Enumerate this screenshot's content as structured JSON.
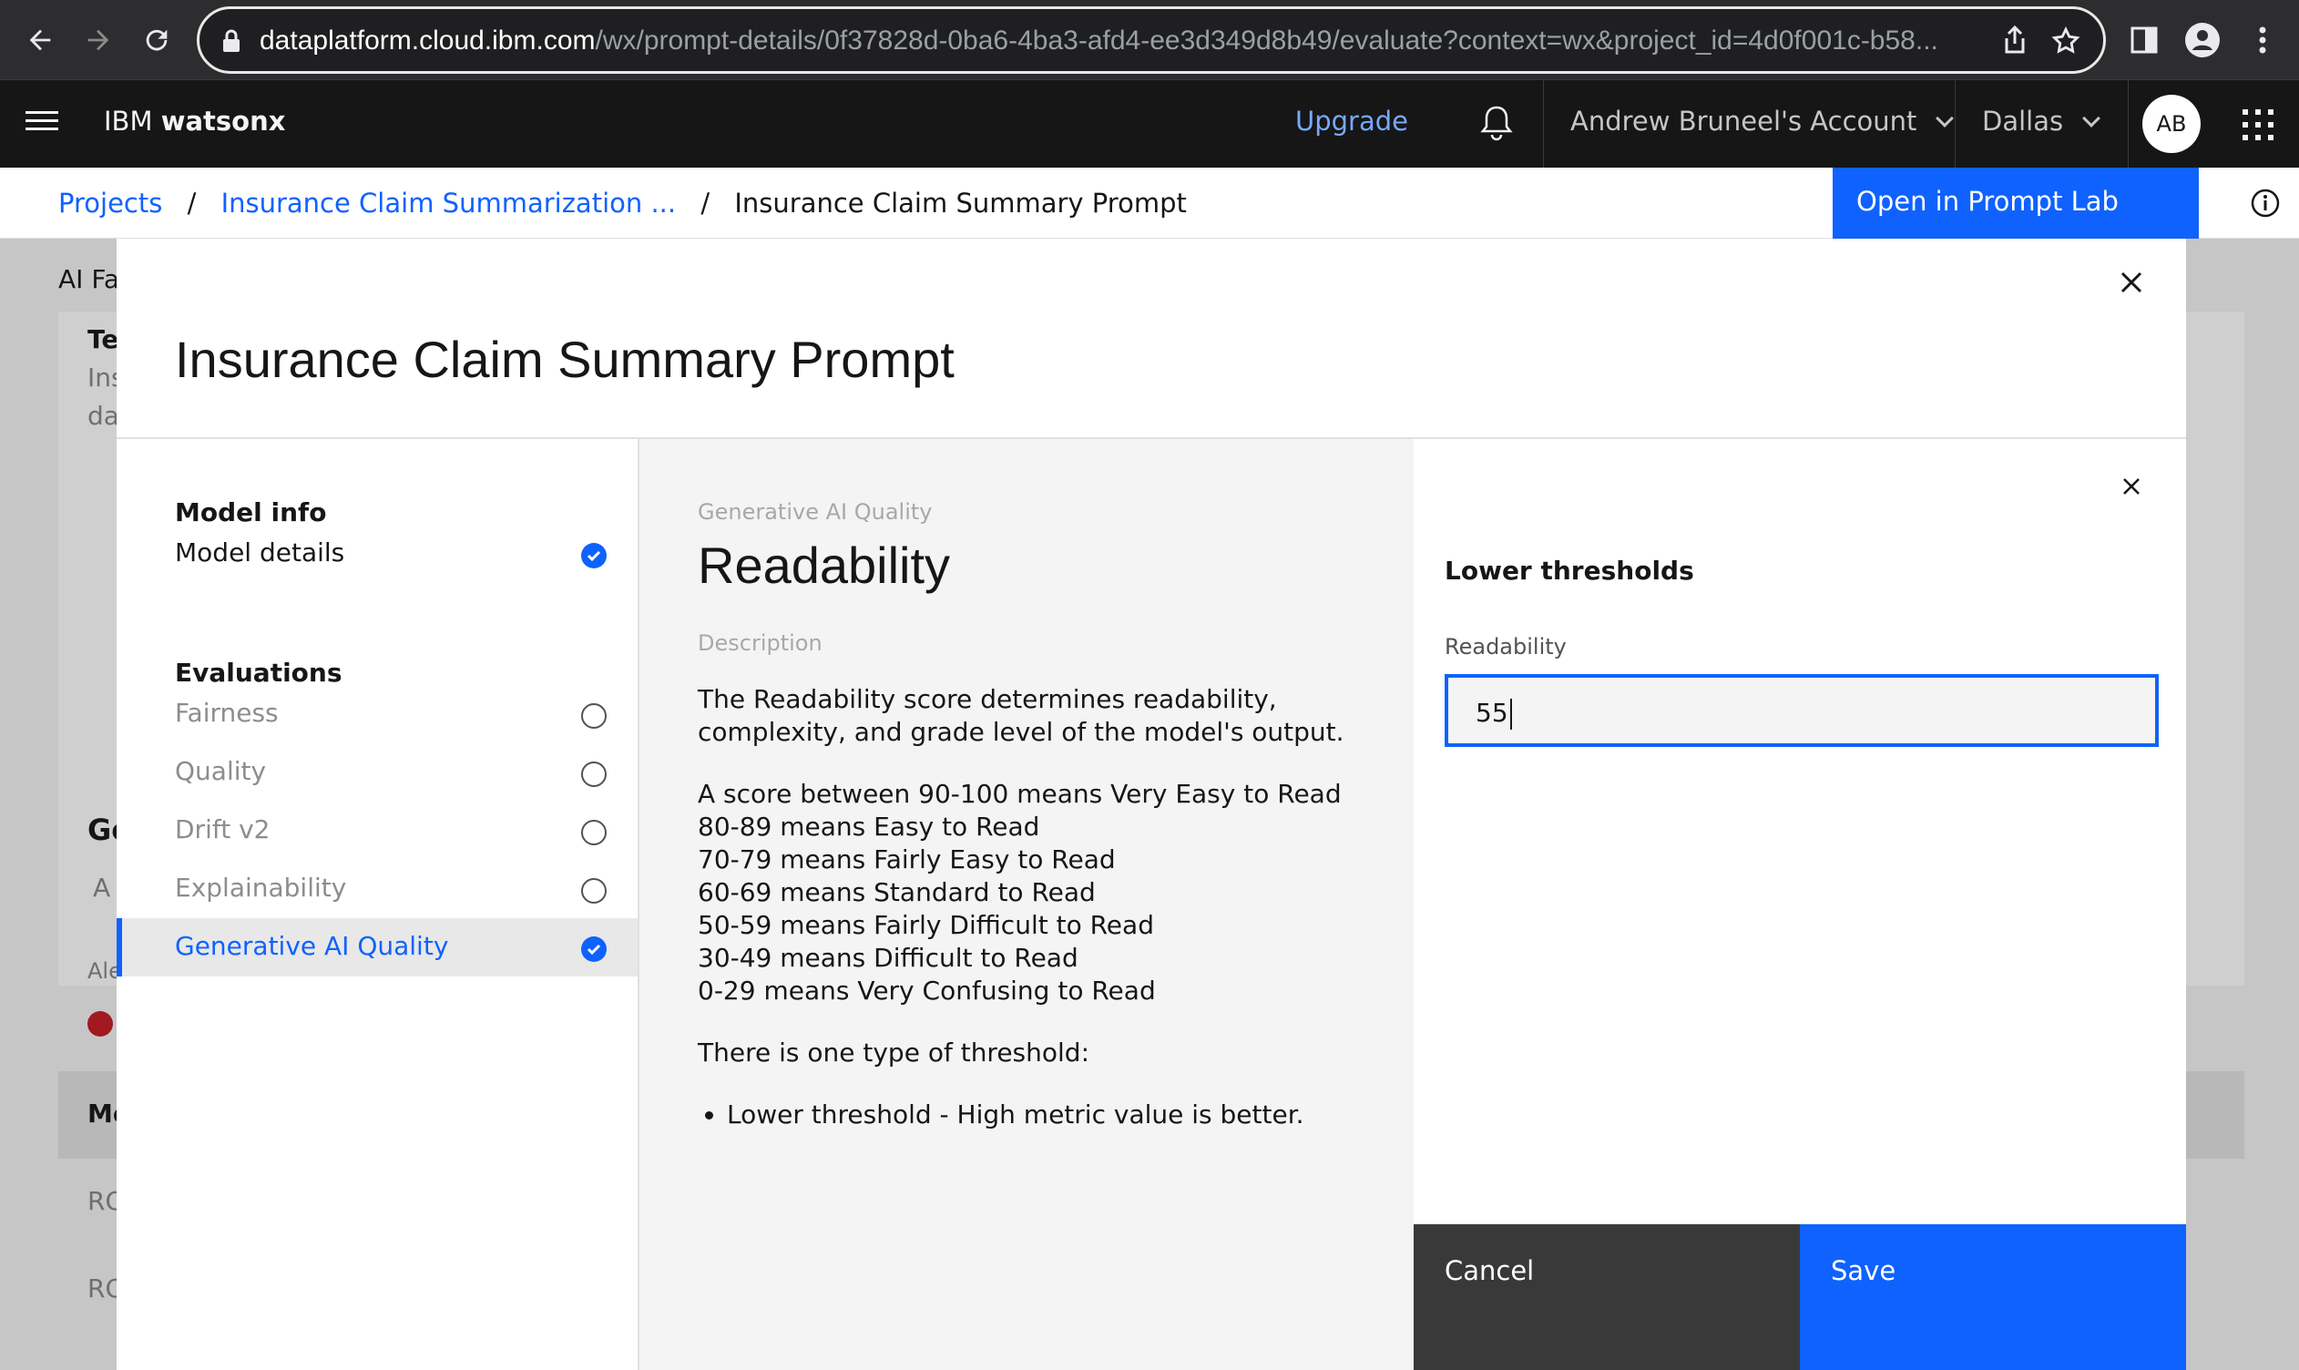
{
  "browser": {
    "url_host": "dataplatform.cloud.ibm.com",
    "url_path": "/wx/prompt-details/0f37828d-0ba6-4ba3-afd4-ee3d349d8b49/evaluate?context=wx&project_id=4d0f001c-b58..."
  },
  "header": {
    "brand_prefix": "IBM ",
    "brand_name": "watsonx",
    "upgrade": "Upgrade",
    "account": "Andrew Bruneel's Account",
    "region": "Dallas",
    "avatar_initials": "AB"
  },
  "breadcrumb": {
    "items": [
      "Projects",
      "Insurance Claim Summarization ..."
    ],
    "separator": "/",
    "current": "Insurance Claim Summary Prompt",
    "open_button": "Open in Prompt Lab"
  },
  "background": {
    "fragments": [
      "AI Fa",
      "Te",
      "Ins",
      "da",
      "Ge",
      "A",
      "Ale",
      "Me",
      "RO",
      "RO"
    ]
  },
  "modal": {
    "title": "Insurance Claim Summary Prompt",
    "nav": {
      "section1": "Model info",
      "model_details": "Model details",
      "section2": "Evaluations",
      "items": [
        "Fairness",
        "Quality",
        "Drift v2",
        "Explainability"
      ],
      "active": "Generative AI Quality"
    },
    "center": {
      "eyebrow": "Generative AI Quality",
      "title": "Readability",
      "desc_label": "Description",
      "intro": "The Readability score determines readability, complexity, and grade level of the model's output.",
      "scale": [
        "A score between 90-100 means Very Easy to Read",
        "80-89 means Easy to Read",
        "70-79 means Fairly Easy to Read",
        "60-69 means Standard to Read",
        "50-59 means Fairly Difficult to Read",
        "30-49 means Difficult to Read",
        "0-29 means Very Confusing to Read"
      ],
      "threshold_intro": "There is one type of threshold:",
      "bullet": "Lower threshold - High metric value is better."
    },
    "panel": {
      "heading": "Lower thresholds",
      "field_label": "Readability",
      "field_value": "55",
      "cancel": "Cancel",
      "save": "Save"
    }
  },
  "colors": {
    "primary": "#0f62fe",
    "header_bg": "#161616",
    "cancel_bg": "#393939"
  }
}
